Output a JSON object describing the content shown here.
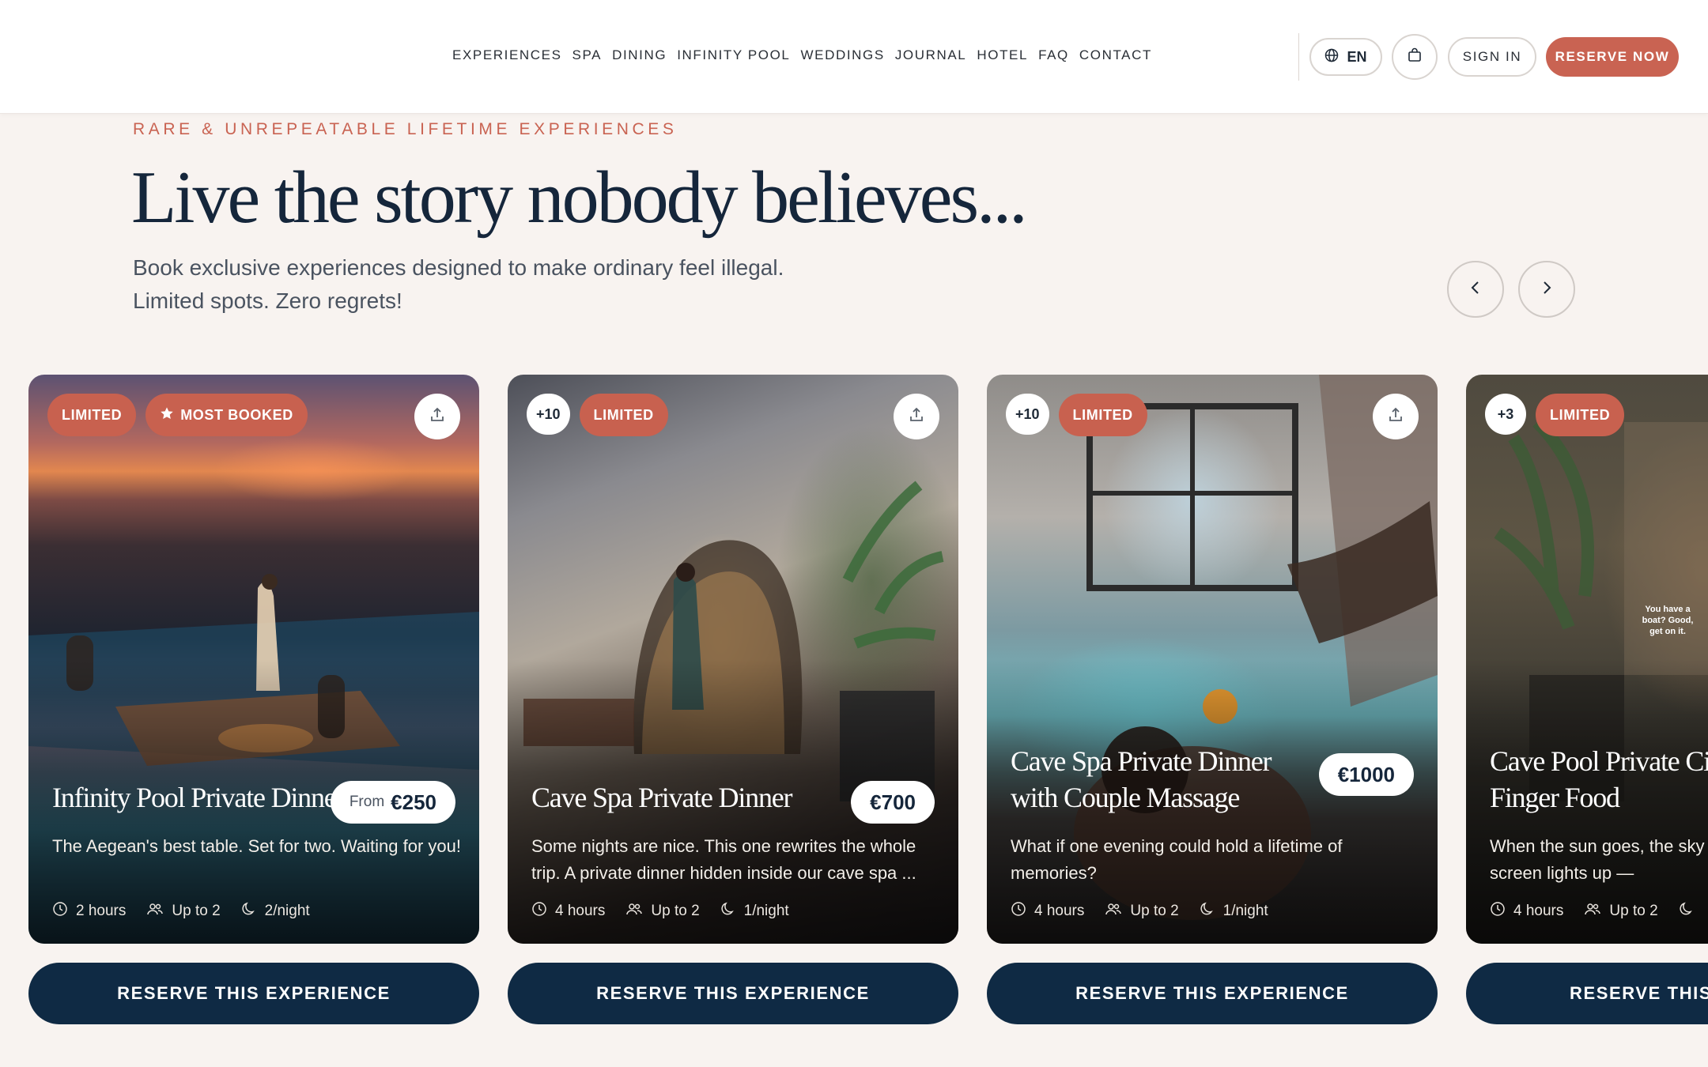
{
  "header": {
    "nav": [
      "EXPERIENCES",
      "SPA",
      "DINING",
      "INFINITY POOL",
      "WEDDINGS",
      "JOURNAL",
      "HOTEL",
      "FAQ",
      "CONTACT"
    ],
    "lang_label": "EN",
    "signin_label": "SIGN IN",
    "reserve_label": "RESERVE NOW",
    "accent_color": "#c96352"
  },
  "hero": {
    "eyebrow": "RARE & UNREPEATABLE LIFETIME EXPERIENCES",
    "title": "Live the story nobody believes...",
    "subtitle_line1": "Book exclusive experiences designed to make ordinary feel illegal.",
    "subtitle_line2": "Limited spots. Zero regrets!"
  },
  "cards": [
    {
      "badge_count": "",
      "badge_limited": "LIMITED",
      "badge_most": "MOST BOOKED",
      "title": "Infinity Pool Private Dinner",
      "price_from": "From",
      "price": "€250",
      "description": "The Aegean's best table. Set for two. Waiting for you!",
      "duration": "2 hours",
      "guests": "Up to 2",
      "availability": "2/night",
      "cta": "RESERVE THIS EXPERIENCE"
    },
    {
      "badge_count": "+10",
      "badge_limited": "LIMITED",
      "title": "Cave Spa Private Dinner",
      "price": "€700",
      "description": "Some nights are nice. This one rewrites the whole trip. A private dinner hidden inside our cave spa ...",
      "duration": "4 hours",
      "guests": "Up to 2",
      "availability": "1/night",
      "cta": "RESERVE THIS EXPERIENCE"
    },
    {
      "badge_count": "+10",
      "badge_limited": "LIMITED",
      "title": "Cave Spa Private Dinner with Couple Massage",
      "price": "€1000",
      "description": "What if one evening could hold a lifetime of memories?",
      "duration": "4 hours",
      "guests": "Up to 2",
      "availability": "1/night",
      "cta": "RESERVE THIS EXPERIENCE"
    },
    {
      "badge_count": "+3",
      "badge_limited": "LIMITED",
      "title": "Cave Pool Private Cinema with Finger Food",
      "image_text": "You have a boat? Good, get on it.",
      "description": "When the sun goes, the sky when the screen lights up —",
      "duration": "4 hours",
      "guests": "Up to 2",
      "cta": "RESERVE THIS EXPERIENCE"
    }
  ]
}
